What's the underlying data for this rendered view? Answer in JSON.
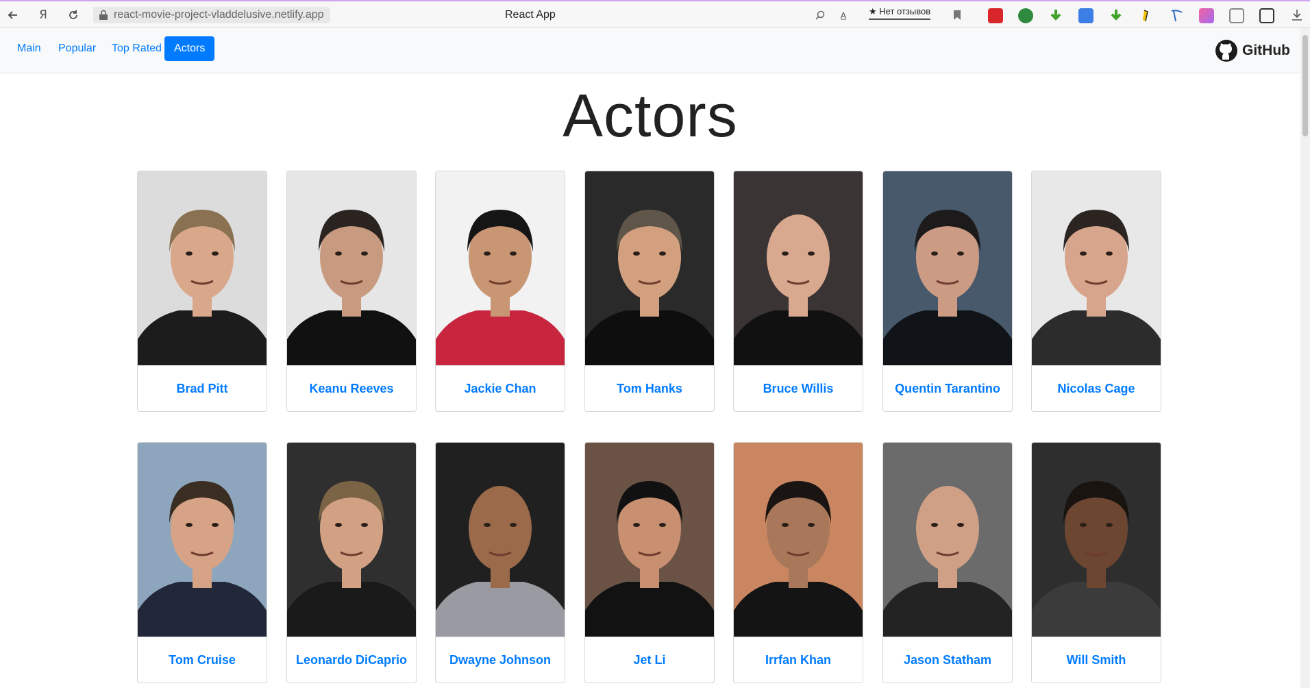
{
  "browser": {
    "url": "react-movie-project-vladdelusive.netlify.app",
    "tab_title": "React App",
    "reviews_label": "★ Нет отзывов"
  },
  "navbar": {
    "items": [
      {
        "label": "Main",
        "active": false
      },
      {
        "label": "Popular",
        "active": false
      },
      {
        "label": "Top Rated",
        "active": false
      },
      {
        "label": "Actors",
        "active": true
      }
    ],
    "github_label": "GitHub"
  },
  "page": {
    "title": "Actors",
    "actors": [
      {
        "name": "Brad Pitt",
        "bg": "#dcdcdc",
        "skin": "#d9a78a",
        "hair": "#8a7151",
        "suit": "#1c1c1c"
      },
      {
        "name": "Keanu Reeves",
        "bg": "#e6e6e6",
        "skin": "#c89a80",
        "hair": "#2a2320",
        "suit": "#111111"
      },
      {
        "name": "Jackie Chan",
        "bg": "#f2f2f2",
        "skin": "#c99673",
        "hair": "#151515",
        "suit": "#c8253e"
      },
      {
        "name": "Tom Hanks",
        "bg": "#2a2a2a",
        "skin": "#d3a07f",
        "hair": "#5f5548",
        "suit": "#0e0e0e"
      },
      {
        "name": "Bruce Willis",
        "bg": "#3a3434",
        "skin": "#d8a98e",
        "hair": "#d8a98e",
        "suit": "#111111"
      },
      {
        "name": "Quentin Tarantino",
        "bg": "#47596a",
        "skin": "#cc9b84",
        "hair": "#1c1a1a",
        "suit": "#101418"
      },
      {
        "name": "Nicolas Cage",
        "bg": "#e8e8e8",
        "skin": "#d7a58c",
        "hair": "#2b2420",
        "suit": "#2c2c2c"
      },
      {
        "name": "Tom Cruise",
        "bg": "#8da6bd",
        "skin": "#d6a386",
        "hair": "#3a2d22",
        "suit": "#22273a"
      },
      {
        "name": "Leonardo DiCaprio",
        "bg": "#2f2f2f",
        "skin": "#d2a183",
        "hair": "#7a6445",
        "suit": "#1a1a1a"
      },
      {
        "name": "Dwayne Johnson",
        "bg": "#202020",
        "skin": "#9a6a4a",
        "hair": "#9a6a4a",
        "suit": "#9a9aa2"
      },
      {
        "name": "Jet Li",
        "bg": "#6a5345",
        "skin": "#c89070",
        "hair": "#111111",
        "suit": "#121212"
      },
      {
        "name": "Irrfan Khan",
        "bg": "#c98660",
        "skin": "#a9785a",
        "hair": "#1a1512",
        "suit": "#141414"
      },
      {
        "name": "Jason Statham",
        "bg": "#6b6b6b",
        "skin": "#cf9f86",
        "hair": "#cf9f86",
        "suit": "#232323"
      },
      {
        "name": "Will Smith",
        "bg": "#2e2e2e",
        "skin": "#6d4632",
        "hair": "#1a1410",
        "suit": "#3b3b3b"
      }
    ]
  }
}
